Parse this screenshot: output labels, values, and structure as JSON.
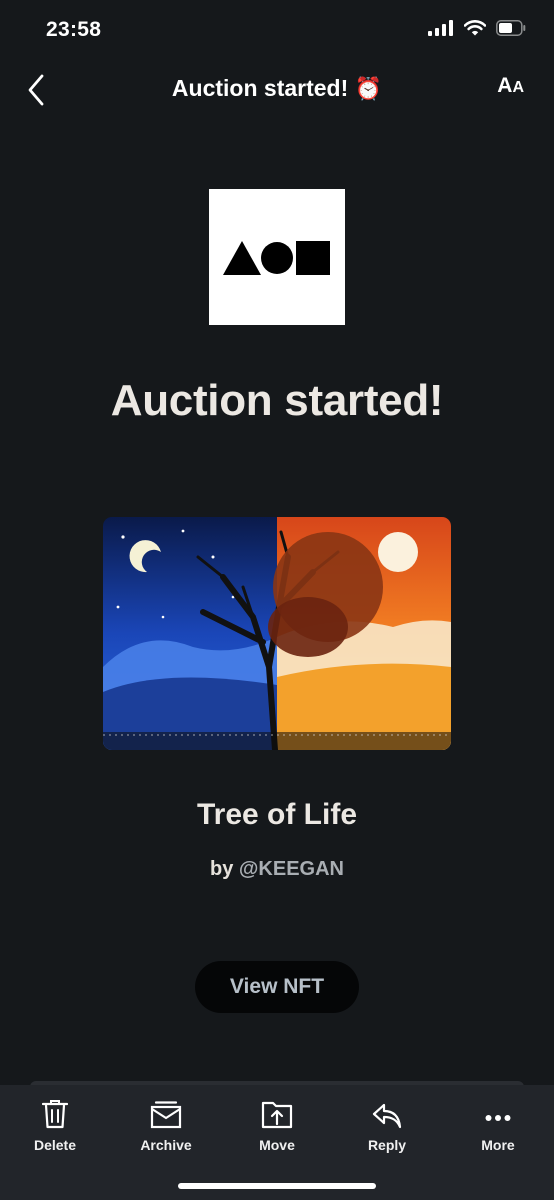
{
  "status_bar": {
    "time": "23:58"
  },
  "header": {
    "title": "Auction started!",
    "title_emoji": "⏰",
    "text_size_label_large": "A",
    "text_size_label_small": "A"
  },
  "email": {
    "headline": "Auction started!",
    "nft_title": "Tree of Life",
    "by_label": "by",
    "creator_handle": "@KEEGAN",
    "view_button_label": "View NFT"
  },
  "toolbar": {
    "items": [
      {
        "label": "Delete",
        "icon": "trash-icon"
      },
      {
        "label": "Archive",
        "icon": "archive-icon"
      },
      {
        "label": "Move",
        "icon": "move-icon"
      },
      {
        "label": "Reply",
        "icon": "reply-icon"
      },
      {
        "label": "More",
        "icon": "more-icon"
      }
    ]
  }
}
